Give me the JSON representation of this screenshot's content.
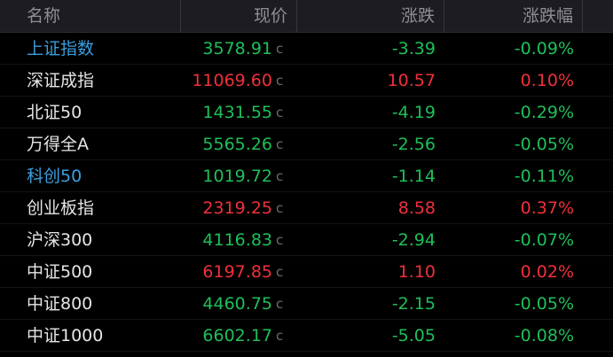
{
  "colors": {
    "up": "#f0303a",
    "down": "#1fbf5a",
    "link_name": "#3a9fe0",
    "name": "#e6e6e6"
  },
  "header": {
    "name": "名称",
    "price": "现价",
    "change": "涨跌",
    "change_pct": "涨跌幅"
  },
  "rows": [
    {
      "name": "上证指数",
      "name_style": "link",
      "price": "3578.91",
      "flag": "c",
      "change": "-3.39",
      "change_pct": "-0.09%",
      "trend": "down"
    },
    {
      "name": "深证成指",
      "name_style": "normal",
      "price": "11069.60",
      "flag": "c",
      "change": "10.57",
      "change_pct": "0.10%",
      "trend": "up"
    },
    {
      "name": "北证50",
      "name_style": "normal",
      "price": "1431.55",
      "flag": "c",
      "change": "-4.19",
      "change_pct": "-0.29%",
      "trend": "down"
    },
    {
      "name": "万得全A",
      "name_style": "normal",
      "price": "5565.26",
      "flag": "c",
      "change": "-2.56",
      "change_pct": "-0.05%",
      "trend": "down"
    },
    {
      "name": "科创50",
      "name_style": "link",
      "price": "1019.72",
      "flag": "c",
      "change": "-1.14",
      "change_pct": "-0.11%",
      "trend": "down"
    },
    {
      "name": "创业板指",
      "name_style": "normal",
      "price": "2319.25",
      "flag": "c",
      "change": "8.58",
      "change_pct": "0.37%",
      "trend": "up"
    },
    {
      "name": "沪深300",
      "name_style": "normal",
      "price": "4116.83",
      "flag": "c",
      "change": "-2.94",
      "change_pct": "-0.07%",
      "trend": "down"
    },
    {
      "name": "中证500",
      "name_style": "normal",
      "price": "6197.85",
      "flag": "c",
      "change": "1.10",
      "change_pct": "0.02%",
      "trend": "up"
    },
    {
      "name": "中证800",
      "name_style": "normal",
      "price": "4460.75",
      "flag": "c",
      "change": "-2.15",
      "change_pct": "-0.05%",
      "trend": "down"
    },
    {
      "name": "中证1000",
      "name_style": "normal",
      "price": "6602.17",
      "flag": "c",
      "change": "-5.05",
      "change_pct": "-0.08%",
      "trend": "down"
    }
  ]
}
